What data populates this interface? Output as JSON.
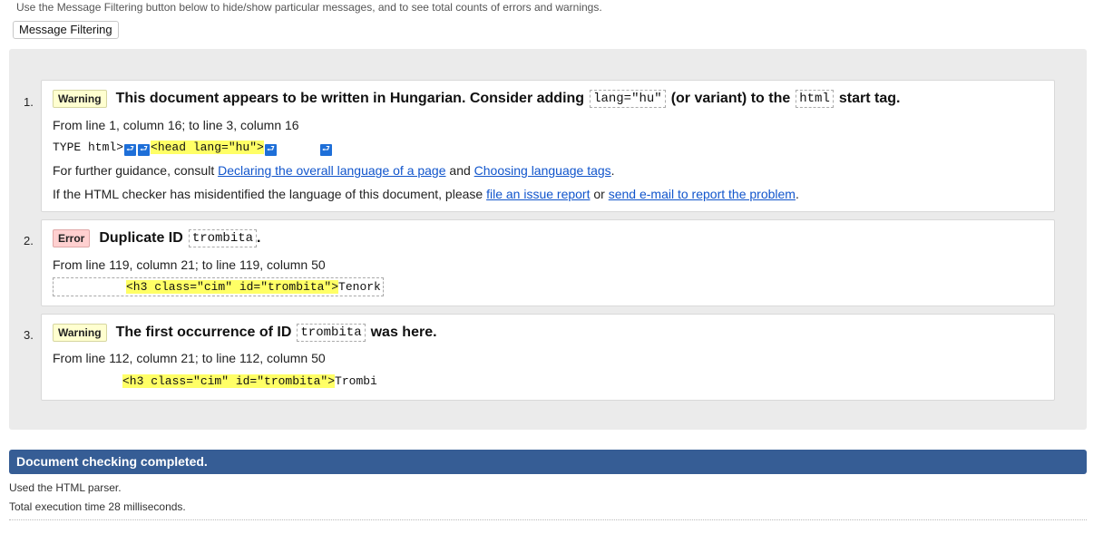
{
  "intro_text": "Use the Message Filtering button below to hide/show particular messages, and to see total counts of errors and warnings.",
  "filter_button_label": "Message Filtering",
  "messages": [
    {
      "number": "1.",
      "type": "Warning",
      "text_a": "This document appears to be written in Hungarian. Consider adding",
      "code_a": "lang=\"hu\"",
      "text_b": "(or variant) to the",
      "code_b": "html",
      "text_c": "start tag.",
      "location": "From line 1, column 16; to line 3, column 16",
      "extract_pre": "TYPE html>",
      "extract_hl": "<head lang=\"hu\">",
      "guidance_pre": "For further guidance, consult",
      "guidance_link1": "Declaring the overall language of a page",
      "guidance_mid": "and",
      "guidance_link2": "Choosing language tags",
      "guidance_end": ".",
      "issue_pre": "If the HTML checker has misidentified the language of this document, please",
      "issue_link1": "file an issue report",
      "issue_mid": "or",
      "issue_link2": "send e-mail to report the problem",
      "issue_end": "."
    },
    {
      "number": "2.",
      "type": "Error",
      "text_a": "Duplicate ID",
      "code_a": "trombita",
      "text_c": ".",
      "location": "From line 119, column 21; to line 119, column 50",
      "extract_hl": "<h3 class=\"cim\" id=\"trombita\">",
      "extract_post": "Tenork"
    },
    {
      "number": "3.",
      "type": "Warning",
      "text_a": "The first occurrence of ID",
      "code_a": "trombita",
      "text_c": "was here.",
      "location": "From line 112, column 21; to line 112, column 50",
      "extract_hl": "<h3 class=\"cim\" id=\"trombita\">",
      "extract_post": "Trombi"
    }
  ],
  "completed_text": "Document checking completed.",
  "parser_text": "Used the HTML parser.",
  "exec_time_text": "Total execution time 28 milliseconds.",
  "colors": {
    "warning_badge": "#ffffd0",
    "error_badge": "#ffd0d0",
    "completed_bar": "#365d95",
    "highlight": "#ffff66",
    "linefeed_icon": "#1e6fd8",
    "link": "#1155cc"
  },
  "icons": {
    "linefeed": "linefeed-icon"
  }
}
